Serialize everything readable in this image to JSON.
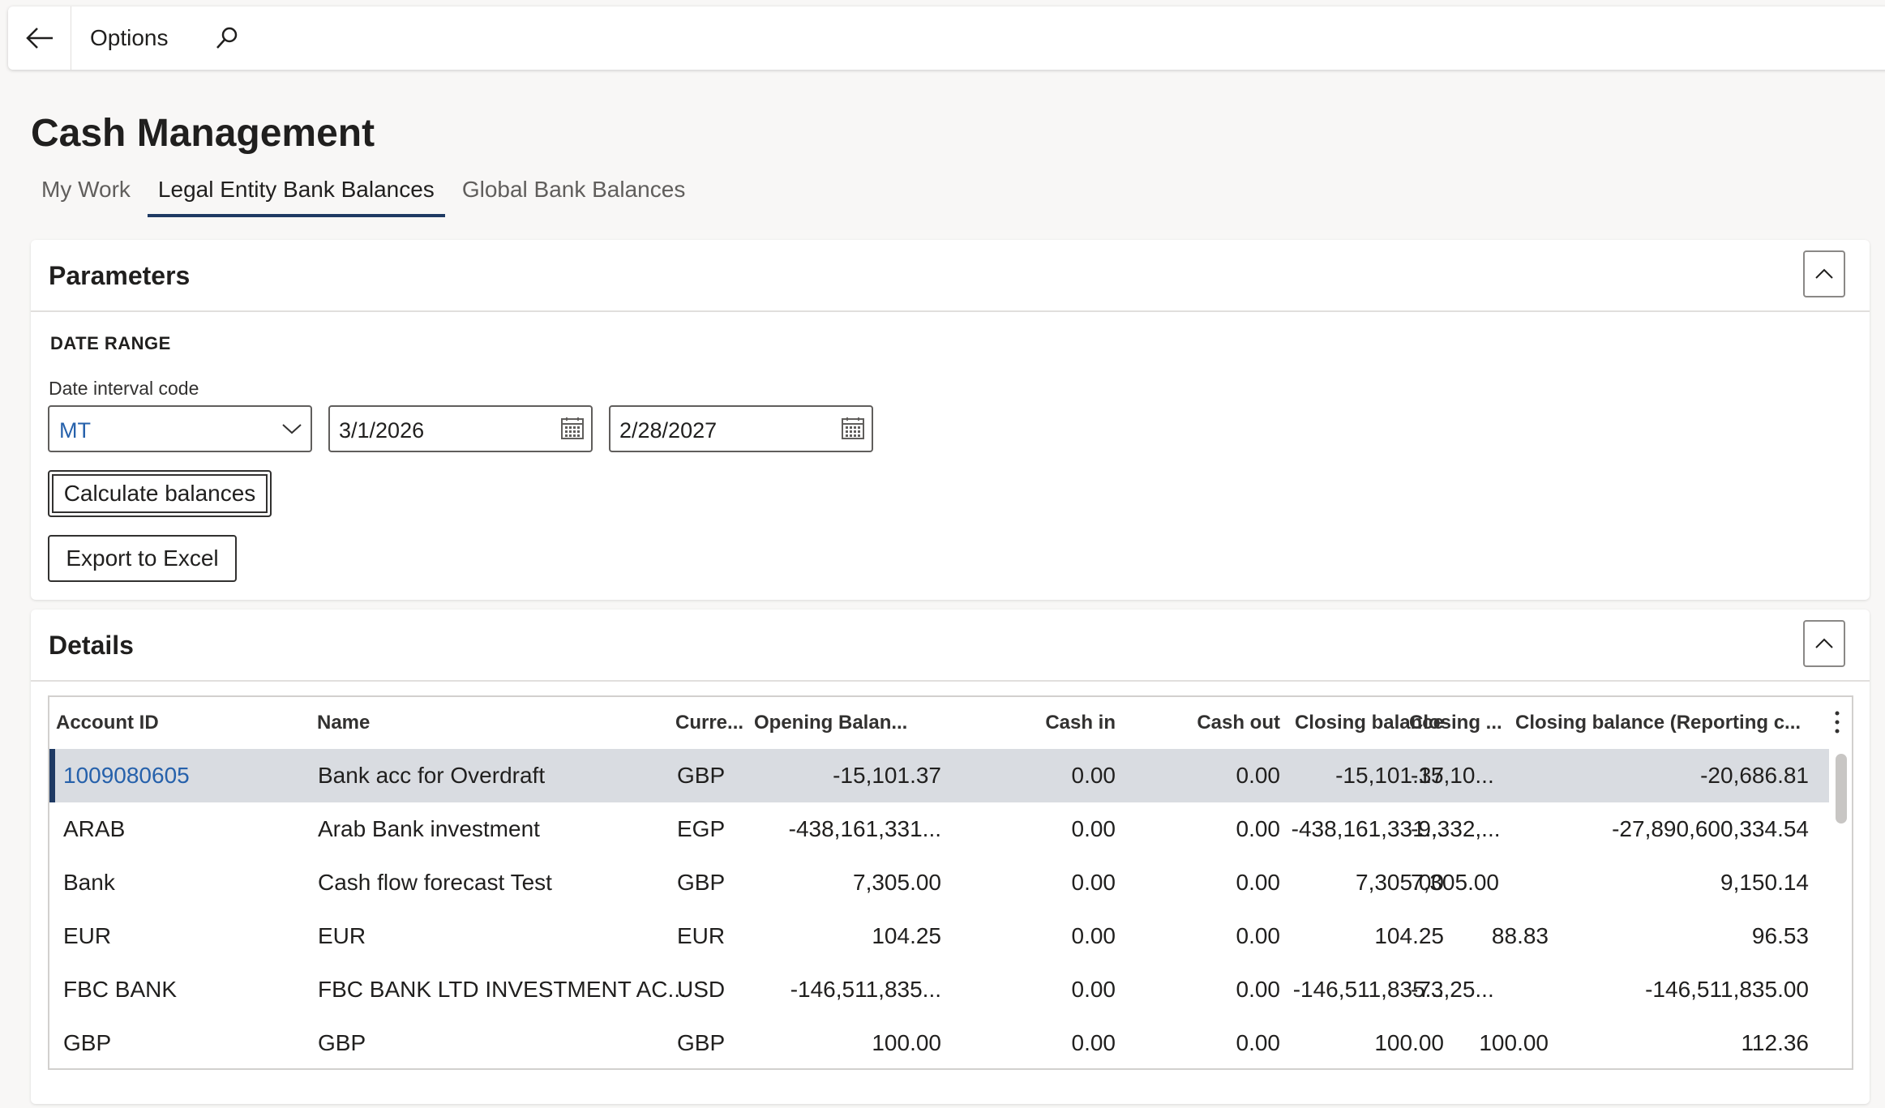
{
  "topbar": {
    "options_label": "Options",
    "back_icon": "back-arrow-icon",
    "search_icon": "search-icon"
  },
  "page": {
    "title": "Cash Management"
  },
  "tabs": [
    {
      "label": "My Work",
      "active": false
    },
    {
      "label": "Legal Entity Bank Balances",
      "active": true
    },
    {
      "label": "Global Bank Balances",
      "active": false
    }
  ],
  "parameters": {
    "title": "Parameters",
    "section_label": "DATE RANGE",
    "date_interval_label": "Date interval code",
    "date_interval_value": "MT",
    "from_date": "3/1/2026",
    "to_date": "2/28/2027",
    "calculate_label": "Calculate balances",
    "export_label": "Export to Excel"
  },
  "details": {
    "title": "Details",
    "columns": [
      "Account ID",
      "Name",
      "Curre...",
      "Opening Balan...",
      "Cash in",
      "Cash out",
      "Closing balance",
      "Closing ...",
      "Closing balance (Reporting c..."
    ],
    "rows": [
      {
        "account_id": "1009080605",
        "name": "Bank acc for Overdraft",
        "currency": "GBP",
        "opening": "-15,101.37",
        "cash_in": "0.00",
        "cash_out": "0.00",
        "closing": "-15,101.37",
        "closing_short": "-15,10...",
        "closing_reporting": "-20,686.81",
        "selected": true
      },
      {
        "account_id": "ARAB",
        "name": "Arab Bank investment",
        "currency": "EGP",
        "opening": "-438,161,331...",
        "cash_in": "0.00",
        "cash_out": "0.00",
        "closing": "-438,161,331...",
        "closing_short": "-9,332,...",
        "closing_reporting": "-27,890,600,334.54",
        "selected": false
      },
      {
        "account_id": "Bank",
        "name": "Cash flow forecast Test",
        "currency": "GBP",
        "opening": "7,305.00",
        "cash_in": "0.00",
        "cash_out": "0.00",
        "closing": "7,305.00",
        "closing_short": "7,305.00",
        "closing_reporting": "9,150.14",
        "selected": false
      },
      {
        "account_id": "EUR",
        "name": "EUR",
        "currency": "EUR",
        "opening": "104.25",
        "cash_in": "0.00",
        "cash_out": "0.00",
        "closing": "104.25",
        "closing_short": "88.83",
        "closing_reporting": "96.53",
        "selected": false
      },
      {
        "account_id": "FBC BANK",
        "name": "FBC BANK LTD INVESTMENT AC...",
        "currency": "USD",
        "opening": "-146,511,835...",
        "cash_in": "0.00",
        "cash_out": "0.00",
        "closing": "-146,511,835...",
        "closing_short": "-73,25...",
        "closing_reporting": "-146,511,835.00",
        "selected": false
      },
      {
        "account_id": "GBP",
        "name": "GBP",
        "currency": "GBP",
        "opening": "100.00",
        "cash_in": "0.00",
        "cash_out": "0.00",
        "closing": "100.00",
        "closing_short": "100.00",
        "closing_reporting": "112.36",
        "selected": false
      }
    ]
  }
}
